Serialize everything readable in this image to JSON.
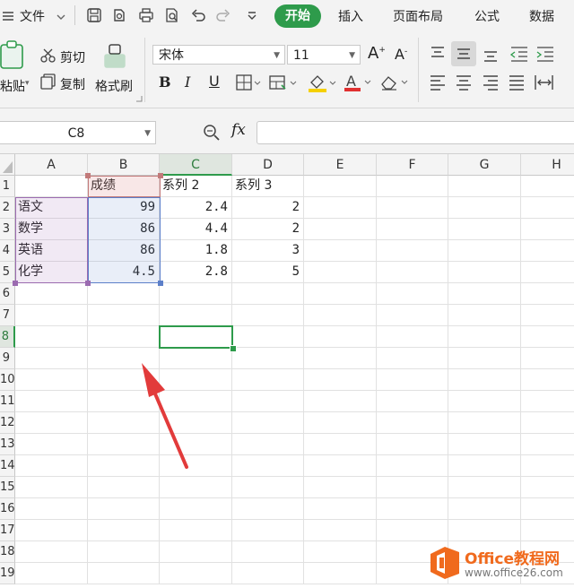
{
  "menu": {
    "file": "文件",
    "tabs": [
      "开始",
      "插入",
      "页面布局",
      "公式",
      "数据"
    ]
  },
  "ribbon": {
    "paste": "粘贴",
    "cut": "剪切",
    "copy": "复制",
    "format_painter": "格式刷",
    "font_name": "宋体",
    "font_size": "11"
  },
  "formula_bar": {
    "name_box": "C8",
    "fx": "fx",
    "formula": ""
  },
  "sheet": {
    "columns": [
      "A",
      "B",
      "C",
      "D",
      "E",
      "F",
      "G",
      "H"
    ],
    "rows": [
      "1",
      "2",
      "3",
      "4",
      "5",
      "6",
      "7",
      "8",
      "9",
      "10",
      "11",
      "12",
      "13",
      "14",
      "15",
      "16",
      "17",
      "18",
      "19"
    ],
    "cells": {
      "B1": "成绩",
      "C1": "系列 2",
      "D1": "系列 3",
      "A2": "语文",
      "B2": "99",
      "C2": "2.4",
      "D2": "2",
      "A3": "数学",
      "B3": "86",
      "C3": "4.4",
      "D3": "2",
      "A4": "英语",
      "B4": "86",
      "C4": "1.8",
      "D4": "3",
      "A5": "化学",
      "B5": "4.5",
      "C5": "2.8",
      "D5": "5"
    },
    "selected_cell": "C8"
  },
  "watermark": {
    "brand": "Office教程网",
    "url": "www.office26.com"
  },
  "colors": {
    "accent_green": "#2e9b4b",
    "arrow_red": "#e23b3b",
    "logo_orange": "#f06a1d"
  }
}
